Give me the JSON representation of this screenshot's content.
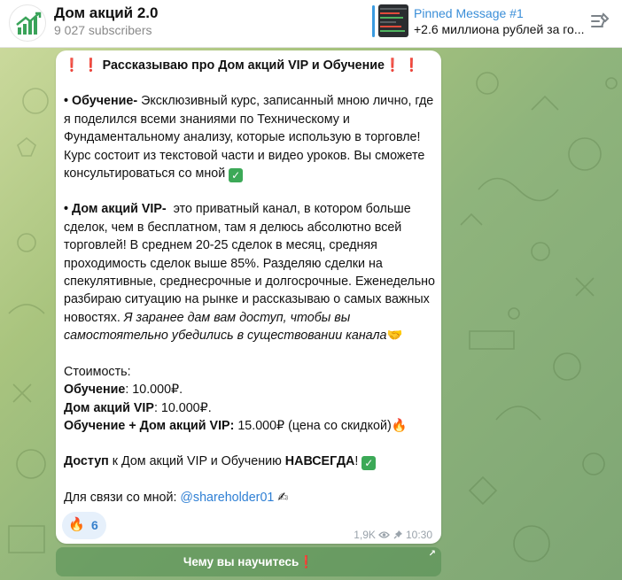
{
  "header": {
    "channel_title": "Дом акций 2.0",
    "subscribers": "9 027 subscribers",
    "pinned_title": "Pinned Message #1",
    "pinned_text": "+2.6 миллиона рублей за го..."
  },
  "message": {
    "heading": "Рассказываю про Дом акций VIP и Обучение",
    "edu_label": "• Обучение-",
    "edu_text": " Эксклюзивный курс, записанный мною лично, где я поделился всеми знаниями по Техническому и Фундаментальному анализу, которые использую в торговле! Курс состоит из текстовой части и видео уроков. Вы сможете консультироваться со мной ",
    "vip_label": "• Дом акций VIP-",
    "vip_text": "  это приватный канал, в котором больше сделок, чем в бесплатном, там я делюсь абсолютно всей торговлей! В среднем 20-25 сделок в месяц, средняя проходимость сделок выше 85%. Разделяю сделки на спекулятивные, среднесрочные и долгосрочные. Еженедельно разбираю ситуацию на рынке и рассказываю о самых важных новостях. ",
    "vip_italic": "Я заранее дам вам доступ, чтобы вы самостоятельно убедились в существовании канала",
    "price_heading": "Стоимость:",
    "price_edu_label": "Обучение",
    "price_edu_value": ": 10.000₽.",
    "price_vip_label": "Дом акций VIP",
    "price_vip_value": ": 10.000₽.",
    "price_combo_label": "Обучение + Дом акций VIP:",
    "price_combo_value": " 15.000₽ (цена со скидкой)",
    "access_label": "Доступ",
    "access_text": " к Дом акций VIP и Обучению ",
    "access_forever": "НАВСЕГДА",
    "access_end": "! ",
    "contact_text": "Для связи со мной: ",
    "contact_link": "@shareholder01",
    "check_glyph": "✓",
    "emoji_fire": "🔥",
    "emoji_handshake": "🤝",
    "emoji_writing": "✍",
    "emoji_excl": "❗"
  },
  "reaction": {
    "emoji": "🔥",
    "count": "6"
  },
  "meta": {
    "views": "1,9K",
    "time": "10:30"
  },
  "inline_button": {
    "label": "Чему вы научитесь",
    "emoji": "❗"
  },
  "colors": {
    "accent": "#3a8ed8",
    "link": "#2e7fd4",
    "check": "#3ca957"
  }
}
